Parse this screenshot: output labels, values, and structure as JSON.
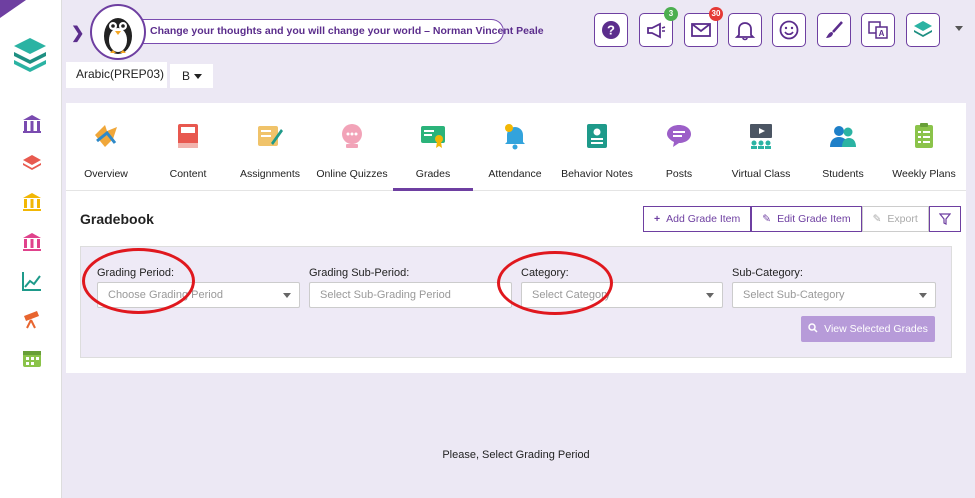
{
  "header": {
    "quote": "Change your thoughts and you will change your world – Norman Vincent Peale",
    "buttons": [
      {
        "name": "help",
        "icon": "question-icon"
      },
      {
        "name": "announcements",
        "icon": "megaphone-icon",
        "badge": "3",
        "badge_color": "#4caf50"
      },
      {
        "name": "messages",
        "icon": "mail-icon",
        "badge": "30",
        "badge_color": "#e53935"
      },
      {
        "name": "notifications",
        "icon": "bell-icon"
      },
      {
        "name": "mood",
        "icon": "smiley-icon"
      },
      {
        "name": "theme",
        "icon": "brush-icon"
      },
      {
        "name": "language",
        "icon": "translate-icon"
      },
      {
        "name": "platform",
        "icon": "layers-icon"
      }
    ]
  },
  "course": {
    "name": "Arabic(PREP03)",
    "section": "B"
  },
  "tabs": [
    {
      "label": "Overview",
      "icon": "overview-icon"
    },
    {
      "label": "Content",
      "icon": "book-icon"
    },
    {
      "label": "Assignments",
      "icon": "assignment-icon"
    },
    {
      "label": "Online Quizzes",
      "icon": "quiz-icon"
    },
    {
      "label": "Grades",
      "icon": "certificate-icon",
      "active": true
    },
    {
      "label": "Attendance",
      "icon": "attendance-bell-icon"
    },
    {
      "label": "Behavior Notes",
      "icon": "behavior-notes-icon"
    },
    {
      "label": "Posts",
      "icon": "chat-bubble-icon"
    },
    {
      "label": "Virtual Class",
      "icon": "virtual-class-icon"
    },
    {
      "label": "Students",
      "icon": "students-icon"
    },
    {
      "label": "Weekly Plans",
      "icon": "weekly-plans-icon"
    }
  ],
  "gradebook": {
    "title": "Gradebook",
    "add_label": "Add Grade Item",
    "edit_label": "Edit Grade Item",
    "export_label": "Export"
  },
  "filters": {
    "grading_period": {
      "label": "Grading Period:",
      "placeholder": "Choose Grading Period"
    },
    "sub_period": {
      "label": "Grading Sub-Period:",
      "placeholder": "Select Sub-Grading Period"
    },
    "category": {
      "label": "Category:",
      "placeholder": "Select Category"
    },
    "sub_category": {
      "label": "Sub-Category:",
      "placeholder": "Select Sub-Category"
    },
    "view_label": "View Selected Grades"
  },
  "empty_message": "Please, Select Grading Period",
  "colors": {
    "accent": "#6e3fa1",
    "highlight": "#e0181e"
  }
}
